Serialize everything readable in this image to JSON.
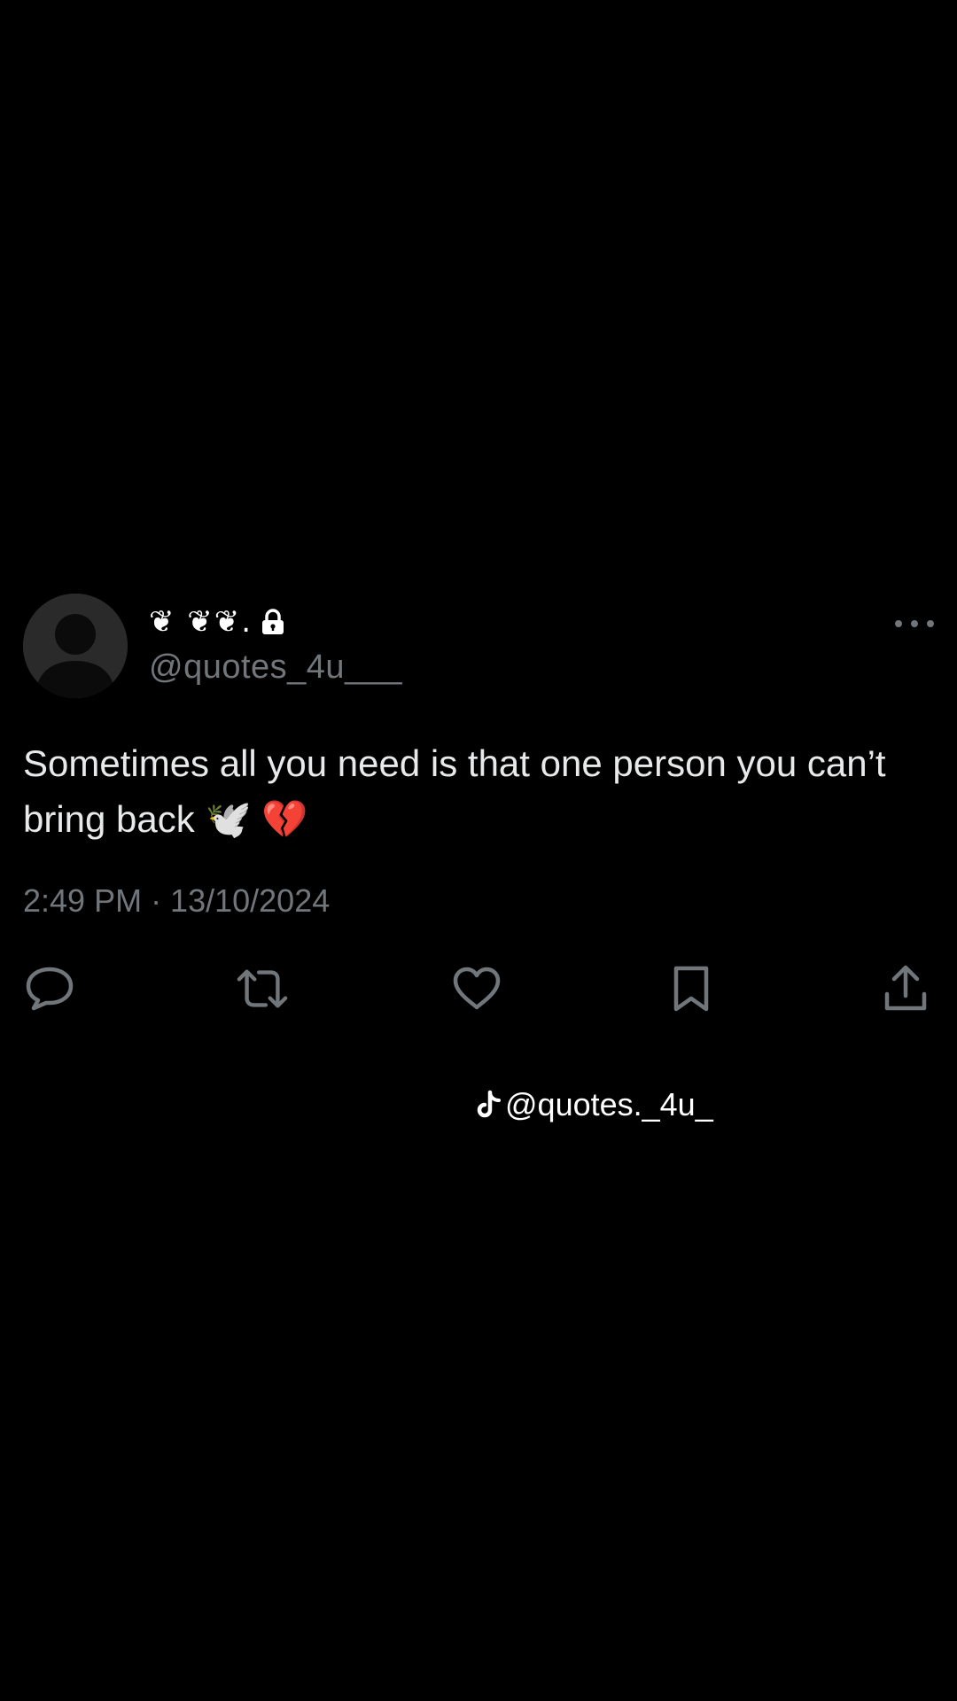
{
  "tweet": {
    "display_name": "❦ ❦❦.",
    "display_name_icon": "lock-icon",
    "handle": "@quotes_4u___",
    "text": "Sometimes all you need is that one person you can’t bring back 🕊️ 💔",
    "timestamp": "2:49 PM · 13/10/2024",
    "actions": [
      "reply-icon",
      "retweet-icon",
      "like-icon",
      "bookmark-icon",
      "share-icon"
    ],
    "more_icon": "more-icon"
  },
  "watermark": {
    "icon": "tiktok-icon",
    "text": "@quotes._4u_"
  },
  "colors": {
    "background": "#000000",
    "primary_text": "#e7e9ea",
    "secondary_text": "#71767b",
    "icon": "#71767b"
  }
}
